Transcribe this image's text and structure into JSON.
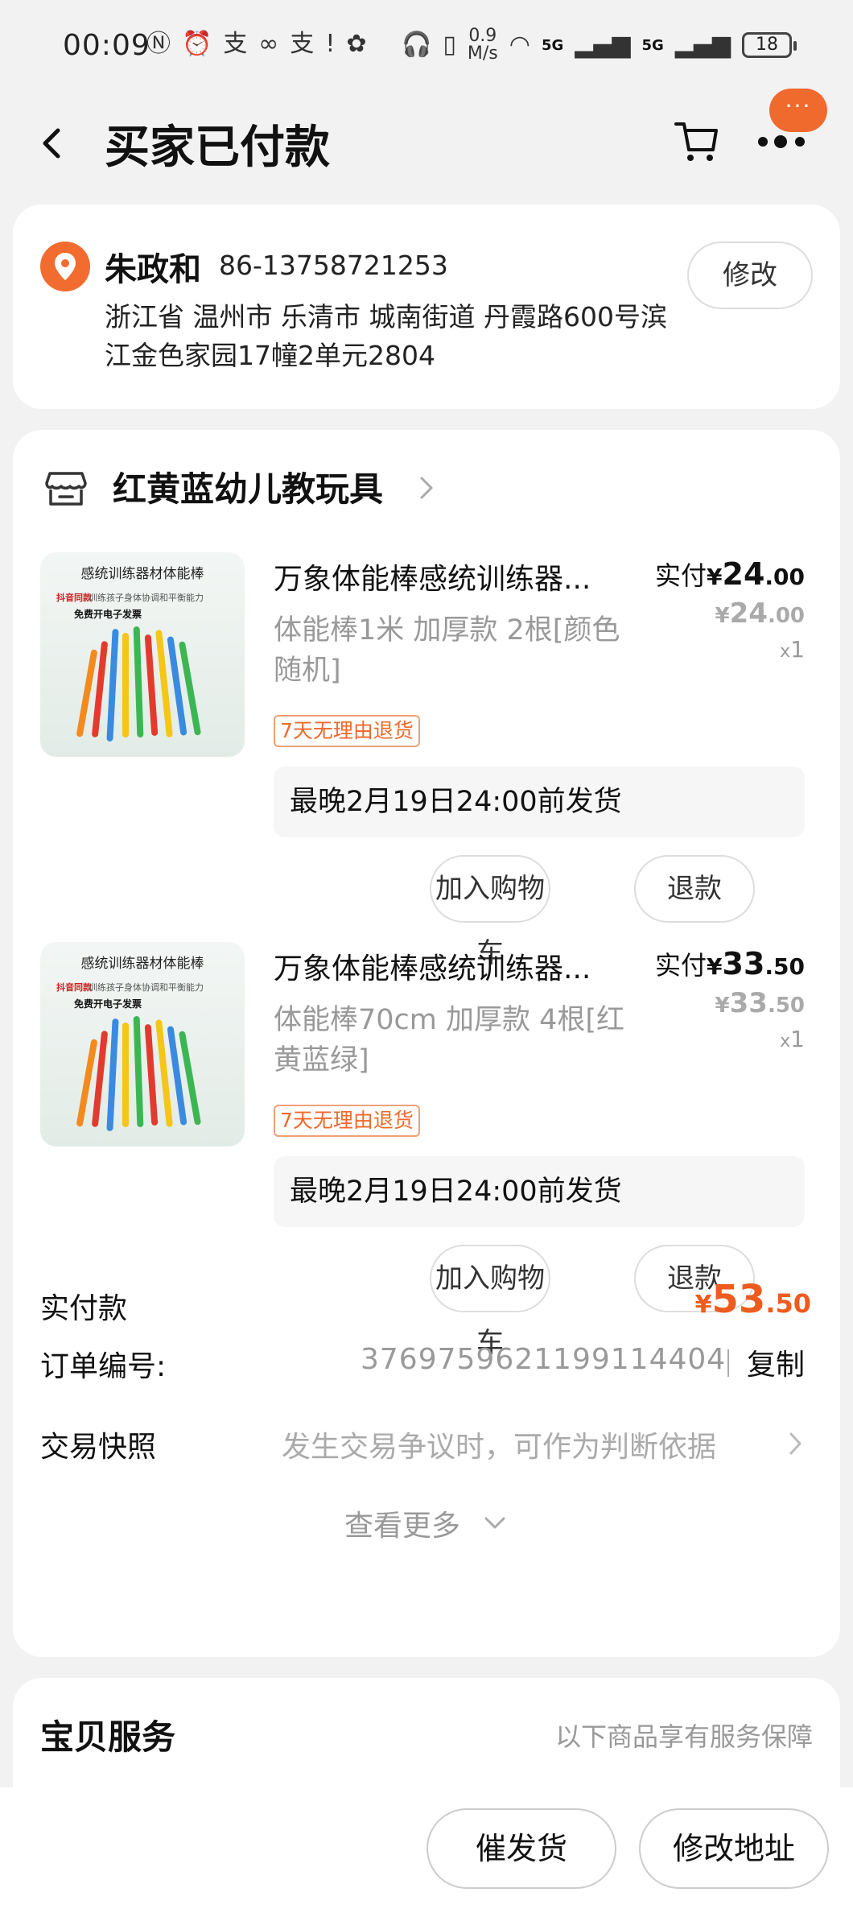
{
  "status_bar": {
    "time": "00:09",
    "speed_value": "0.9",
    "speed_unit": "M/s",
    "signal_1": "5G",
    "signal_2": "5G",
    "battery": "18"
  },
  "header": {
    "title": "买家已付款",
    "more_badge": "···"
  },
  "address": {
    "name": "朱政和",
    "phone": "86-13758721253",
    "detail": "浙江省 温州市 乐清市 城南街道 丹霞路600号滨江金色家园17幢2单元2804",
    "modify_label": "修改"
  },
  "shop": {
    "name": "红黄蓝幼儿教玩具"
  },
  "thumbnail": {
    "title": "感统训练器材体能棒",
    "tag_red": "抖音同款",
    "tag_sub": "训练孩子身体协调和平衡能力",
    "bold_text": "免费开电子发票"
  },
  "items": [
    {
      "title": "万象体能棒感统训练器...",
      "spec": "体能棒1米 加厚款 2根[颜色随机]",
      "return_tag": "7天无理由退货",
      "paid_label": "实付",
      "paid_yen": "¥",
      "paid_int": "24",
      "paid_dec": ".00",
      "orig_yen": "¥",
      "orig_int": "24",
      "orig_dec": ".00",
      "qty_x": "x",
      "qty": "1",
      "ship_notice": "最晚2月19日24:00前发货",
      "add_cart_label": "加入购物车",
      "refund_label": "退款"
    },
    {
      "title": "万象体能棒感统训练器...",
      "spec": "体能棒70cm 加厚款 4根[红黄蓝绿]",
      "return_tag": "7天无理由退货",
      "paid_label": "实付",
      "paid_yen": "¥",
      "paid_int": "33",
      "paid_dec": ".50",
      "orig_yen": "¥",
      "orig_int": "33",
      "orig_dec": ".50",
      "qty_x": "x",
      "qty": "1",
      "ship_notice": "最晚2月19日24:00前发货",
      "add_cart_label": "加入购物车",
      "refund_label": "退款"
    }
  ],
  "summary": {
    "total_label": "实付款",
    "total_yen": "¥",
    "total_int": "53",
    "total_dec": ".50",
    "order_no_label": "订单编号:",
    "order_no": "3769759621199114404",
    "copy_label": "复制",
    "snapshot_label": "交易快照",
    "snapshot_hint": "发生交易争议时，可作为判断依据",
    "see_more": "查看更多"
  },
  "service": {
    "title": "宝贝服务",
    "hint": "以下商品享有服务保障"
  },
  "bottom_bar": {
    "urge_label": "催发货",
    "change_address_label": "修改地址"
  },
  "colors": {
    "accent": "#ee5b1e",
    "badge": "#f06a2e",
    "background": "#f2f2f2"
  }
}
